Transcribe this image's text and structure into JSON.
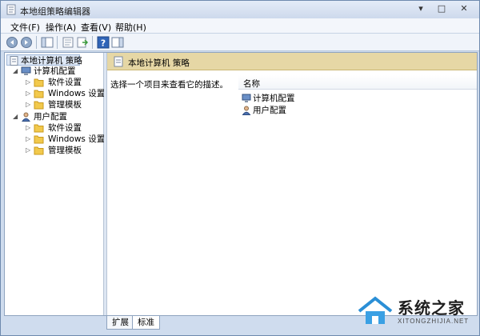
{
  "window": {
    "title": "本地组策略编辑器",
    "controls": {
      "minimize": "▾",
      "maximize": "□",
      "close": "✕"
    }
  },
  "menubar": {
    "items": [
      "文件(F)",
      "操作(A)",
      "查看(V)",
      "帮助(H)"
    ]
  },
  "toolbar": {
    "buttons": [
      "back-icon",
      "forward-icon",
      "show-hide-tree-icon",
      "properties-icon",
      "export-list-icon",
      "help-icon",
      "show-hide-action-pane-icon"
    ]
  },
  "tree": {
    "root": "本地计算机 策略",
    "computer_config": {
      "label": "计算机配置",
      "children": [
        "软件设置",
        "Windows 设置",
        "管理模板"
      ]
    },
    "user_config": {
      "label": "用户配置",
      "children": [
        "软件设置",
        "Windows 设置",
        "管理模板"
      ]
    }
  },
  "right_pane": {
    "header_title": "本地计算机 策略",
    "description": "选择一个项目来查看它的描述。",
    "column_name": "名称",
    "items": [
      "计算机配置",
      "用户配置"
    ]
  },
  "tabs": [
    "扩展",
    "标准"
  ],
  "watermark": {
    "text": "系统之家",
    "sub": "XITONGZHIJIA.NET"
  },
  "colors": {
    "header_band": "#e6d7a5",
    "folder": "#f2c94c",
    "title_bg": "#cdd9ec"
  }
}
